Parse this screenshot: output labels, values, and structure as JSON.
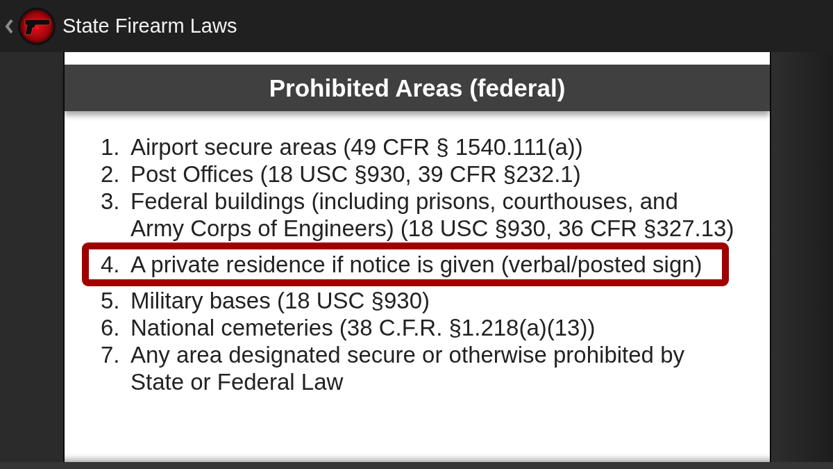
{
  "app_bar": {
    "title": "State Firearm Laws"
  },
  "page": {
    "heading": "Prohibited Areas (federal)",
    "items": [
      {
        "number": "1.",
        "text": "Airport secure areas (49 CFR § 1540.111(a))",
        "highlighted": false
      },
      {
        "number": "2.",
        "text": "Post Offices (18 USC §930, 39 CFR §232.1)",
        "highlighted": false
      },
      {
        "number": "3.",
        "text": "Federal buildings (including prisons, courthouses, and Army Corps of Engineers) (18 USC §930, 36 CFR §327.13)",
        "highlighted": false
      },
      {
        "number": "4.",
        "text": "A private residence if notice is given (verbal/posted sign)",
        "highlighted": true
      },
      {
        "number": "5.",
        "text": "Military bases (18 USC §930)",
        "highlighted": false
      },
      {
        "number": "6.",
        "text": "National cemeteries (38 C.F.R. §1.218(a)(13))",
        "highlighted": false
      },
      {
        "number": "7.",
        "text": "Any area designated secure or otherwise prohibited by State or Federal Law",
        "highlighted": false
      }
    ]
  }
}
